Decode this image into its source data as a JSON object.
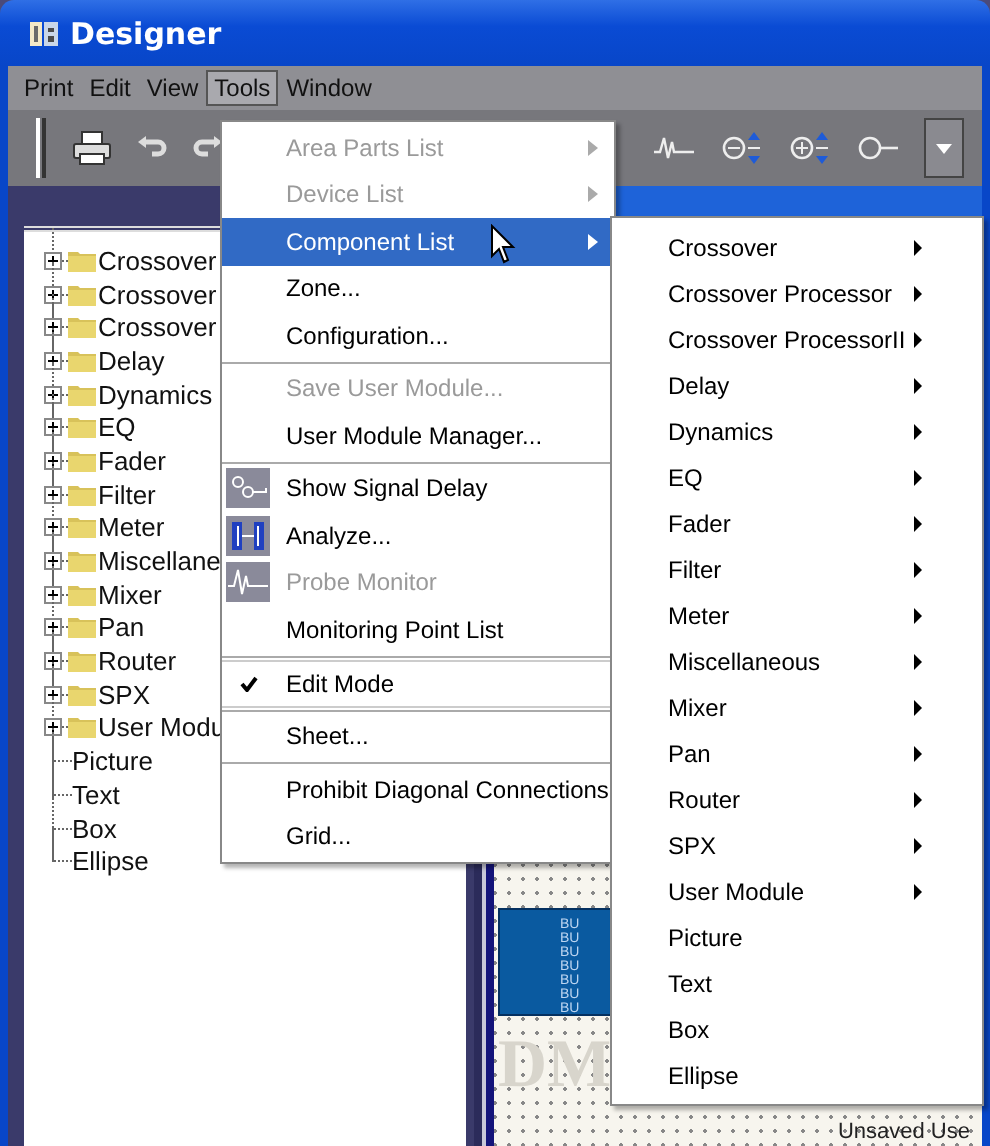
{
  "window": {
    "title": "Designer"
  },
  "menu_bar": [
    {
      "label": "Print",
      "selected": false
    },
    {
      "label": "Edit",
      "selected": false
    },
    {
      "label": "View",
      "selected": false
    },
    {
      "label": "Tools",
      "selected": true
    },
    {
      "label": "Window",
      "selected": false
    }
  ],
  "tree": [
    {
      "label": "Crossover",
      "kind": "folder",
      "expanded": false
    },
    {
      "label": "Crossover",
      "kind": "folder",
      "expanded": false
    },
    {
      "label": "Crossover",
      "kind": "folder",
      "expanded": false
    },
    {
      "label": "Delay",
      "kind": "folder",
      "expanded": false
    },
    {
      "label": "Dynamics",
      "kind": "folder",
      "expanded": false
    },
    {
      "label": "EQ",
      "kind": "folder",
      "expanded": false
    },
    {
      "label": "Fader",
      "kind": "folder",
      "expanded": false
    },
    {
      "label": "Filter",
      "kind": "folder",
      "expanded": false
    },
    {
      "label": "Meter",
      "kind": "folder",
      "expanded": false
    },
    {
      "label": "Miscellane",
      "kind": "folder",
      "expanded": false
    },
    {
      "label": "Mixer",
      "kind": "folder",
      "expanded": false
    },
    {
      "label": "Pan",
      "kind": "folder",
      "expanded": false
    },
    {
      "label": "Router",
      "kind": "folder",
      "expanded": false
    },
    {
      "label": "SPX",
      "kind": "folder",
      "expanded": false
    },
    {
      "label": "User Modu",
      "kind": "folder",
      "expanded": false
    },
    {
      "label": "Picture",
      "kind": "leaf"
    },
    {
      "label": "Text",
      "kind": "leaf"
    },
    {
      "label": "Box",
      "kind": "leaf"
    },
    {
      "label": "Ellipse",
      "kind": "leaf"
    }
  ],
  "tools_menu": [
    {
      "kind": "item",
      "label": "Area Parts List",
      "disabled": true,
      "submenu": true,
      "selected": false
    },
    {
      "kind": "item",
      "label": "Device List",
      "disabled": true,
      "submenu": true,
      "selected": false
    },
    {
      "kind": "item",
      "label": "Component List",
      "disabled": false,
      "submenu": true,
      "selected": true
    },
    {
      "kind": "item",
      "label": "Zone...",
      "disabled": false,
      "submenu": false,
      "selected": false
    },
    {
      "kind": "item",
      "label": "Configuration...",
      "disabled": false,
      "submenu": false,
      "selected": false
    },
    {
      "kind": "separator"
    },
    {
      "kind": "item",
      "label": "Save User Module...",
      "disabled": true,
      "submenu": false,
      "selected": false
    },
    {
      "kind": "item",
      "label": "User Module Manager...",
      "disabled": false,
      "submenu": false,
      "selected": false
    },
    {
      "kind": "separator"
    },
    {
      "kind": "icon",
      "label": "Show Signal Delay",
      "disabled": false,
      "selected": false
    },
    {
      "kind": "icon",
      "label": "Analyze...",
      "disabled": false,
      "selected": false
    },
    {
      "kind": "icon",
      "label": "Probe Monitor",
      "disabled": true,
      "selected": false
    },
    {
      "kind": "item",
      "label": "Monitoring Point List",
      "disabled": false,
      "submenu": false,
      "selected": false
    },
    {
      "kind": "separator"
    },
    {
      "kind": "check",
      "label": "Edit Mode",
      "checked": true,
      "selected": false
    },
    {
      "kind": "separator"
    },
    {
      "kind": "item",
      "label": "Sheet...",
      "disabled": false,
      "submenu": false,
      "selected": false
    },
    {
      "kind": "separator"
    },
    {
      "kind": "item",
      "label": "Prohibit Diagonal Connections",
      "disabled": false,
      "submenu": false,
      "selected": false
    },
    {
      "kind": "item",
      "label": "Grid...",
      "disabled": false,
      "submenu": false,
      "selected": false
    }
  ],
  "component_submenu": [
    {
      "label": "Crossover",
      "submenu": true
    },
    {
      "label": "Crossover Processor",
      "submenu": true
    },
    {
      "label": "Crossover ProcessorII",
      "submenu": true
    },
    {
      "label": "Delay",
      "submenu": true
    },
    {
      "label": "Dynamics",
      "submenu": true
    },
    {
      "label": "EQ",
      "submenu": true
    },
    {
      "label": "Fader",
      "submenu": true
    },
    {
      "label": "Filter",
      "submenu": true
    },
    {
      "label": "Meter",
      "submenu": true
    },
    {
      "label": "Miscellaneous",
      "submenu": true
    },
    {
      "label": "Mixer",
      "submenu": true
    },
    {
      "label": "Pan",
      "submenu": true
    },
    {
      "label": "Router",
      "submenu": true
    },
    {
      "label": "SPX",
      "submenu": true
    },
    {
      "label": "User Module",
      "submenu": true
    },
    {
      "label": "Picture",
      "submenu": false
    },
    {
      "label": "Text",
      "submenu": false
    },
    {
      "label": "Box",
      "submenu": false
    },
    {
      "label": "Ellipse",
      "submenu": false
    }
  ],
  "canvas": {
    "block_lines": [
      "BU",
      "BU",
      "BU",
      "BU",
      "BU",
      "BU",
      "BU"
    ],
    "logo_text": "DM",
    "status": "Unsaved Use"
  }
}
